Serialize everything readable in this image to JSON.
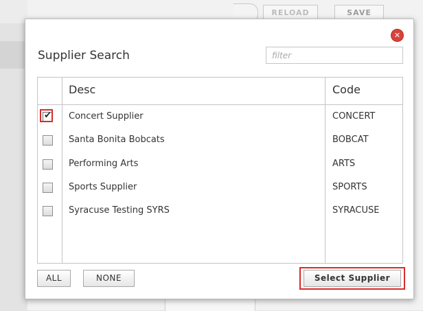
{
  "background": {
    "reload_label": "RELOAD",
    "save_label": "SAVE"
  },
  "dialog": {
    "title": "Supplier Search",
    "filter_placeholder": "filter",
    "close_icon": "close-icon",
    "columns": {
      "desc": "Desc",
      "code": "Code"
    },
    "rows": [
      {
        "desc": "Concert Supplier",
        "code": "CONCERT",
        "checked": true
      },
      {
        "desc": "Santa Bonita Bobcats",
        "code": "BOBCAT",
        "checked": false
      },
      {
        "desc": "Performing Arts",
        "code": "ARTS",
        "checked": false
      },
      {
        "desc": "Sports Supplier",
        "code": "SPORTS",
        "checked": false
      },
      {
        "desc": "Syracuse Testing SYRS",
        "code": "SYRACUSE",
        "checked": false
      }
    ],
    "buttons": {
      "all": "ALL",
      "none": "NONE",
      "select": "Select Supplier"
    }
  },
  "colors": {
    "highlight": "#d52b2b",
    "close": "#d9423b"
  }
}
